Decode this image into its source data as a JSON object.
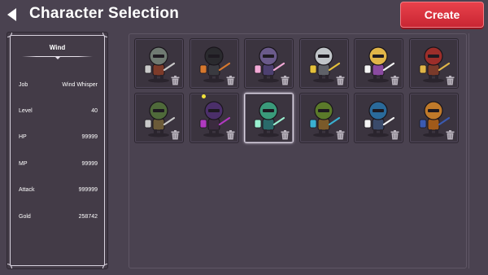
{
  "header": {
    "title": "Character Selection",
    "create_label": "Create"
  },
  "info": {
    "name": "Wind",
    "stats": [
      {
        "label": "Job",
        "value": "Wind Whisper"
      },
      {
        "label": "Level",
        "value": "40"
      },
      {
        "label": "HP",
        "value": "99999"
      },
      {
        "label": "MP",
        "value": "99999"
      },
      {
        "label": "Attack",
        "value": "999999"
      },
      {
        "label": "Gold",
        "value": "258742"
      }
    ]
  },
  "colors": {
    "background": "#4a4250",
    "panel": "#433b47",
    "slot": "#3b343f",
    "create_button": "#d8303c",
    "selected_border": "#d9d2df"
  },
  "characters": [
    {
      "slot": 1,
      "look": "bucket-helm-knight",
      "selected": false
    },
    {
      "slot": 2,
      "look": "masked-ninja-shield",
      "selected": false
    },
    {
      "slot": 3,
      "look": "winged-cat-helm",
      "selected": false
    },
    {
      "slot": 4,
      "look": "silver-helm-knight",
      "selected": false
    },
    {
      "slot": 5,
      "look": "angel-wing-helm",
      "selected": false
    },
    {
      "slot": 6,
      "look": "red-hood-shield",
      "selected": false
    },
    {
      "slot": 7,
      "look": "green-hat-swordsman",
      "selected": false
    },
    {
      "slot": 8,
      "look": "purple-wizard-hat",
      "selected": false
    },
    {
      "slot": 9,
      "look": "wind-whisper-spirit",
      "selected": true
    },
    {
      "slot": 10,
      "look": "feather-hat-ranger",
      "selected": false
    },
    {
      "slot": 11,
      "look": "blue-winged-helm",
      "selected": false
    },
    {
      "slot": 12,
      "look": "golden-armor-shield",
      "selected": false
    }
  ]
}
